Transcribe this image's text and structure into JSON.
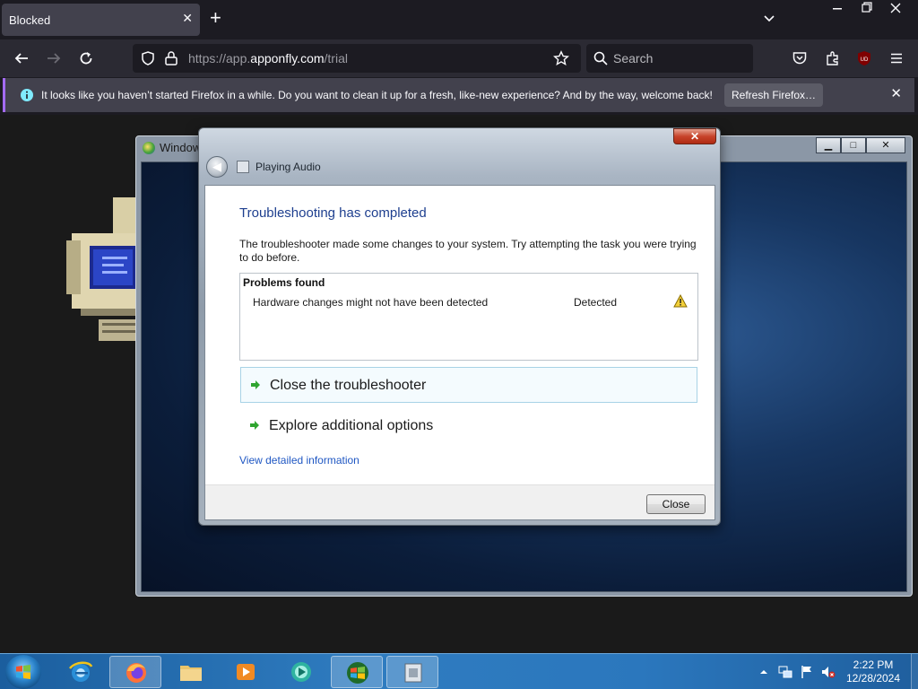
{
  "browser": {
    "tab_title": "Blocked",
    "url_prefix": "https://app.",
    "url_domain": "apponfly.com",
    "url_path": "/trial",
    "search_placeholder": "Search",
    "notification": {
      "text": "It looks like you haven’t started Firefox in a while. Do you want to clean it up for a fresh, like-new experience? And by the way, welcome back!",
      "button": "Refresh Firefox…"
    },
    "accent_color": "#a46bf2"
  },
  "remote": {
    "bg_window_title": "Windows",
    "dialog": {
      "app_title": "Playing Audio",
      "heading": "Troubleshooting has completed",
      "description": "The troubleshooter made some changes to your system. Try attempting the task you were trying to do before.",
      "problems_header": "Problems found",
      "problems": [
        {
          "name": "Hardware changes might not have been detected",
          "status": "Detected",
          "icon": "warning-icon"
        }
      ],
      "options": [
        {
          "label": "Close the troubleshooter",
          "selected": true
        },
        {
          "label": "Explore additional options",
          "selected": false
        }
      ],
      "link": "View detailed information",
      "close_button": "Close"
    }
  },
  "taskbar": {
    "items": [
      "internet-explorer",
      "firefox",
      "file-explorer",
      "media-player",
      "media-center",
      "windows-update",
      "troubleshooter"
    ],
    "active_items": [
      "firefox",
      "windows-update",
      "troubleshooter"
    ],
    "clock_time": "2:22 PM",
    "clock_date": "12/28/2024"
  }
}
